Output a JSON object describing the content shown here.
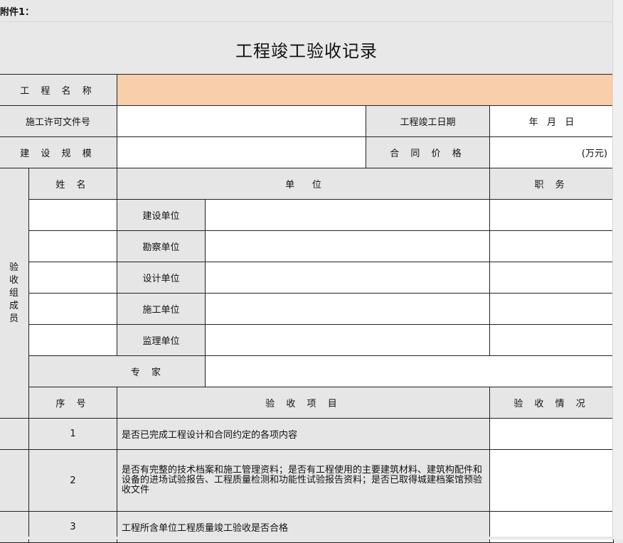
{
  "annex_label": "附件1：",
  "title": "工程竣工验收记录",
  "rows": {
    "project_name_label": "工 程 名 称",
    "project_name_value": "",
    "permit_label": "施工许可文件号",
    "permit_value": "",
    "completion_date_label": "工程竣工日期",
    "completion_date_value": "年   月   日",
    "scale_label": "建 设 规  模",
    "scale_value": "",
    "contract_price_label": "合 同 价 格",
    "contract_price_unit": "(万元)"
  },
  "committee": {
    "side_label": "验收组成员",
    "col_name": "姓  名",
    "col_unit": "单      位",
    "col_position": "职  务",
    "units": [
      "建设单位",
      "勘察单位",
      "设计单位",
      "施工单位",
      "监理单位"
    ],
    "expert_label": "专  家"
  },
  "items": {
    "col_seq": "序  号",
    "col_item": "验 收 项 目",
    "col_status": "验 收 情 况",
    "list": [
      {
        "seq": "1",
        "text": "是否已完成工程设计和合同约定的各项内容"
      },
      {
        "seq": "2",
        "text": "是否有完整的技术档案和施工管理资料；是否有工程使用的主要建筑材料、建筑构配件和设备的进场试验报告、工程质量检测和功能性试验报告资料；是否已取得城建档案馆预验收文件"
      },
      {
        "seq": "3",
        "text": "工程所含单位工程质量竣工验收是否合格"
      }
    ]
  }
}
